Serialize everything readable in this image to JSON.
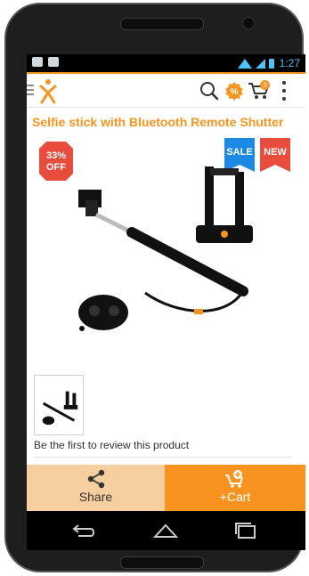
{
  "status_bar": {
    "time": "1:27",
    "notification_icons": [
      "bag-notification-icon",
      "bag-notification-icon"
    ],
    "system_icons": [
      "wifi-icon",
      "signal-icon",
      "battery-icon"
    ]
  },
  "app_bar": {
    "logo_icon": "app-logo-icon",
    "cart_count": "3",
    "icons": [
      "menu-icon",
      "search-icon",
      "offer-percent-icon",
      "cart-icon",
      "more-vertical-icon"
    ]
  },
  "product": {
    "title": "Selfie stick with Bluetooth Remote Shutter",
    "discount_line1": "33%",
    "discount_line2": "OFF",
    "badges": [
      "SALE",
      "NEW"
    ],
    "review_prompt": "Be the first to review this product"
  },
  "bottom_bar": {
    "share_label": "Share",
    "cart_label": "+Cart"
  },
  "colors": {
    "accent": "#f7931e",
    "share_bg": "#f6cea0",
    "discount_red": "#e74c3c",
    "sale_blue": "#1e88e5",
    "new_red": "#e74c3c"
  }
}
